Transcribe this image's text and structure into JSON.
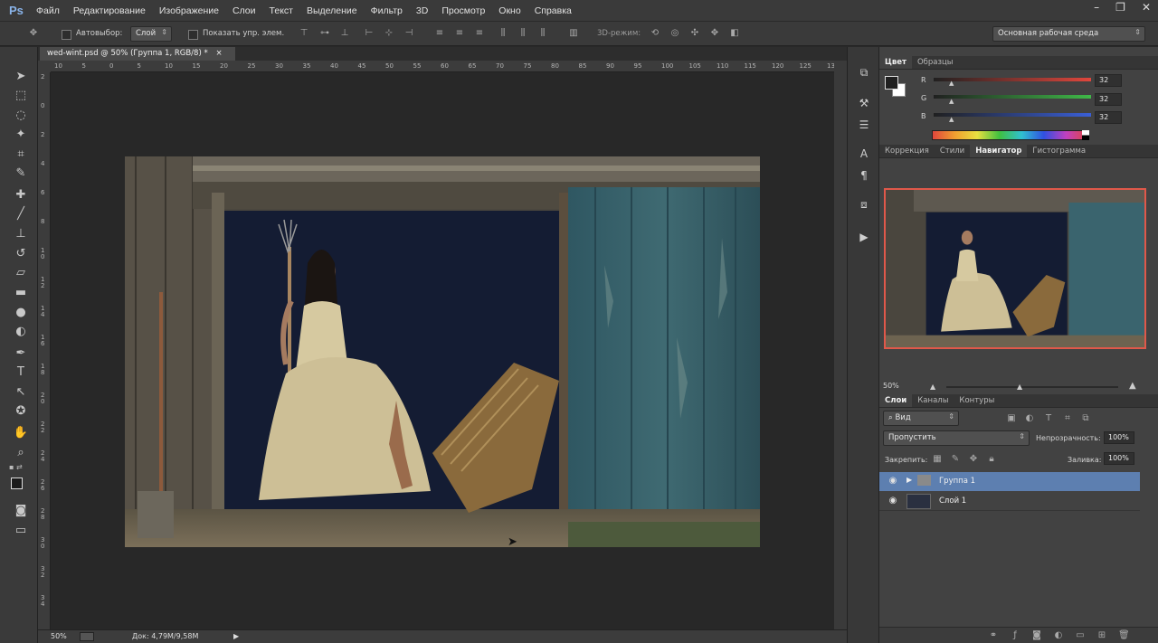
{
  "menu": {
    "logo": "Ps",
    "items": [
      "Файл",
      "Редактирование",
      "Изображение",
      "Слои",
      "Текст",
      "Выделение",
      "Фильтр",
      "3D",
      "Просмотр",
      "Окно",
      "Справка"
    ],
    "window_controls": [
      "–",
      "❐",
      "✕"
    ]
  },
  "options": {
    "autoselect_label": "Автовыбор:",
    "autoselect_value": "Слой",
    "show_controls_label": "Показать упр. элем.",
    "mode_3d_label": "3D-режим:",
    "workspace": "Основная рабочая среда"
  },
  "document": {
    "tab_title": "wed-wint.psd @ 50% (Группа 1, RGB/8) *",
    "close_glyph": "×"
  },
  "rulers": {
    "h_labels": [
      "10",
      "5",
      "0",
      "5",
      "10",
      "15",
      "20",
      "25",
      "30",
      "35",
      "40",
      "45",
      "50",
      "55",
      "60",
      "65",
      "70",
      "75",
      "80",
      "85",
      "90",
      "95",
      "100",
      "105",
      "110",
      "115",
      "120",
      "125",
      "13"
    ],
    "v_labels": [
      "2",
      "0",
      "2",
      "4",
      "6",
      "8",
      "1 0",
      "1 2",
      "1 4",
      "1 6",
      "1 8",
      "2 0",
      "2 2",
      "2 4",
      "2 6",
      "2 8",
      "3 0",
      "3 2",
      "3 4"
    ]
  },
  "status": {
    "zoom": "50%",
    "doc_info": "Док: 4,79M/9,58M",
    "arrow": "▶"
  },
  "color_panel": {
    "tabs": [
      "Цвет",
      "Образцы"
    ],
    "channels": [
      {
        "label": "R",
        "value": "32",
        "color": "#e0463c"
      },
      {
        "label": "G",
        "value": "32",
        "color": "#3fb948"
      },
      {
        "label": "B",
        "value": "32",
        "color": "#3a5fd6"
      }
    ]
  },
  "navigator_panel": {
    "tabs": [
      "Коррекция",
      "Стили",
      "Навигатор",
      "Гистограмма"
    ],
    "zoom": "50%",
    "frame_color": "#e0584a"
  },
  "layers_panel": {
    "tabs": [
      "Слои",
      "Каналы",
      "Контуры"
    ],
    "filter_label": "Вид",
    "blend_mode": "Пропустить",
    "opacity_label": "Непрозрачность:",
    "opacity_value": "100%",
    "lock_label": "Закрепить:",
    "fill_label": "Заливка:",
    "fill_value": "100%",
    "layers": [
      {
        "name": "Группа 1",
        "selected": true,
        "type": "group"
      },
      {
        "name": "Слой 1",
        "selected": false,
        "type": "image"
      }
    ]
  },
  "accent": "#5d7fb0"
}
